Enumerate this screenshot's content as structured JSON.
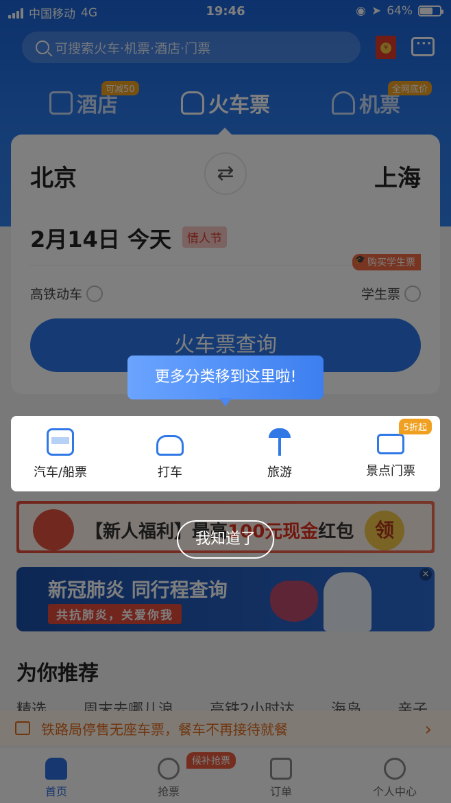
{
  "status_bar": {
    "carrier": "中国移动",
    "network": "4G",
    "time": "19:46",
    "battery": "64%",
    "battery_level": 0.64
  },
  "search": {
    "placeholder": "可搜索火车·机票·酒店·门票"
  },
  "redpacket": {
    "coin": "¥"
  },
  "top_tabs": [
    {
      "label": "酒店",
      "badge": "可减50",
      "icon": "hotel-icon"
    },
    {
      "label": "火车票",
      "badge": "",
      "icon": "train-icon"
    },
    {
      "label": "机票",
      "badge": "全网底价",
      "icon": "plane-icon"
    }
  ],
  "booking": {
    "from_city": "北京",
    "to_city": "上海",
    "swap_glyph": "⇄",
    "date": "2月14日 今天",
    "holiday": "情人节",
    "student_tag": "购买学生票",
    "option_left": "高铁动车",
    "option_right": "学生票",
    "query_button": "火车票查询"
  },
  "guide": {
    "tip": "更多分类移到这里啦!",
    "dismiss": "我知道了"
  },
  "categories": [
    {
      "label": "汽车/船票",
      "icon": "bus-icon",
      "badge": ""
    },
    {
      "label": "打车",
      "icon": "car-icon",
      "badge": ""
    },
    {
      "label": "旅游",
      "icon": "palm-tree-icon",
      "badge": ""
    },
    {
      "label": "景点门票",
      "icon": "ticket-icon",
      "badge": "5折起"
    }
  ],
  "promo1": {
    "prefix": "【新人福利】最高",
    "highlight": "100元现金",
    "suffix": "红包",
    "action": "领"
  },
  "promo2": {
    "title": "新冠肺炎 同行程查询",
    "subtitle": "共抗肺炎，关爱你我",
    "close": "×"
  },
  "recommend": {
    "title": "为你推荐",
    "tabs": [
      "精选",
      "周末去哪儿浪",
      "高铁2小时达",
      "海岛",
      "亲子"
    ]
  },
  "notice": {
    "text": "铁路局停售无座车票，餐车不再接待就餐",
    "arrow": "›"
  },
  "bottom_nav": [
    {
      "label": "首页",
      "icon": "home-icon",
      "active": true
    },
    {
      "label": "抢票",
      "icon": "pulse-icon",
      "active": false
    },
    {
      "label": "订单",
      "icon": "order-icon",
      "active": false
    },
    {
      "label": "个人中心",
      "icon": "profile-icon",
      "active": false
    }
  ],
  "nav_badge": "候补抢票",
  "colors": {
    "primary": "#2c77e8",
    "accent": "#f0a020",
    "overlay": "rgba(0,0,0,0.5)"
  }
}
